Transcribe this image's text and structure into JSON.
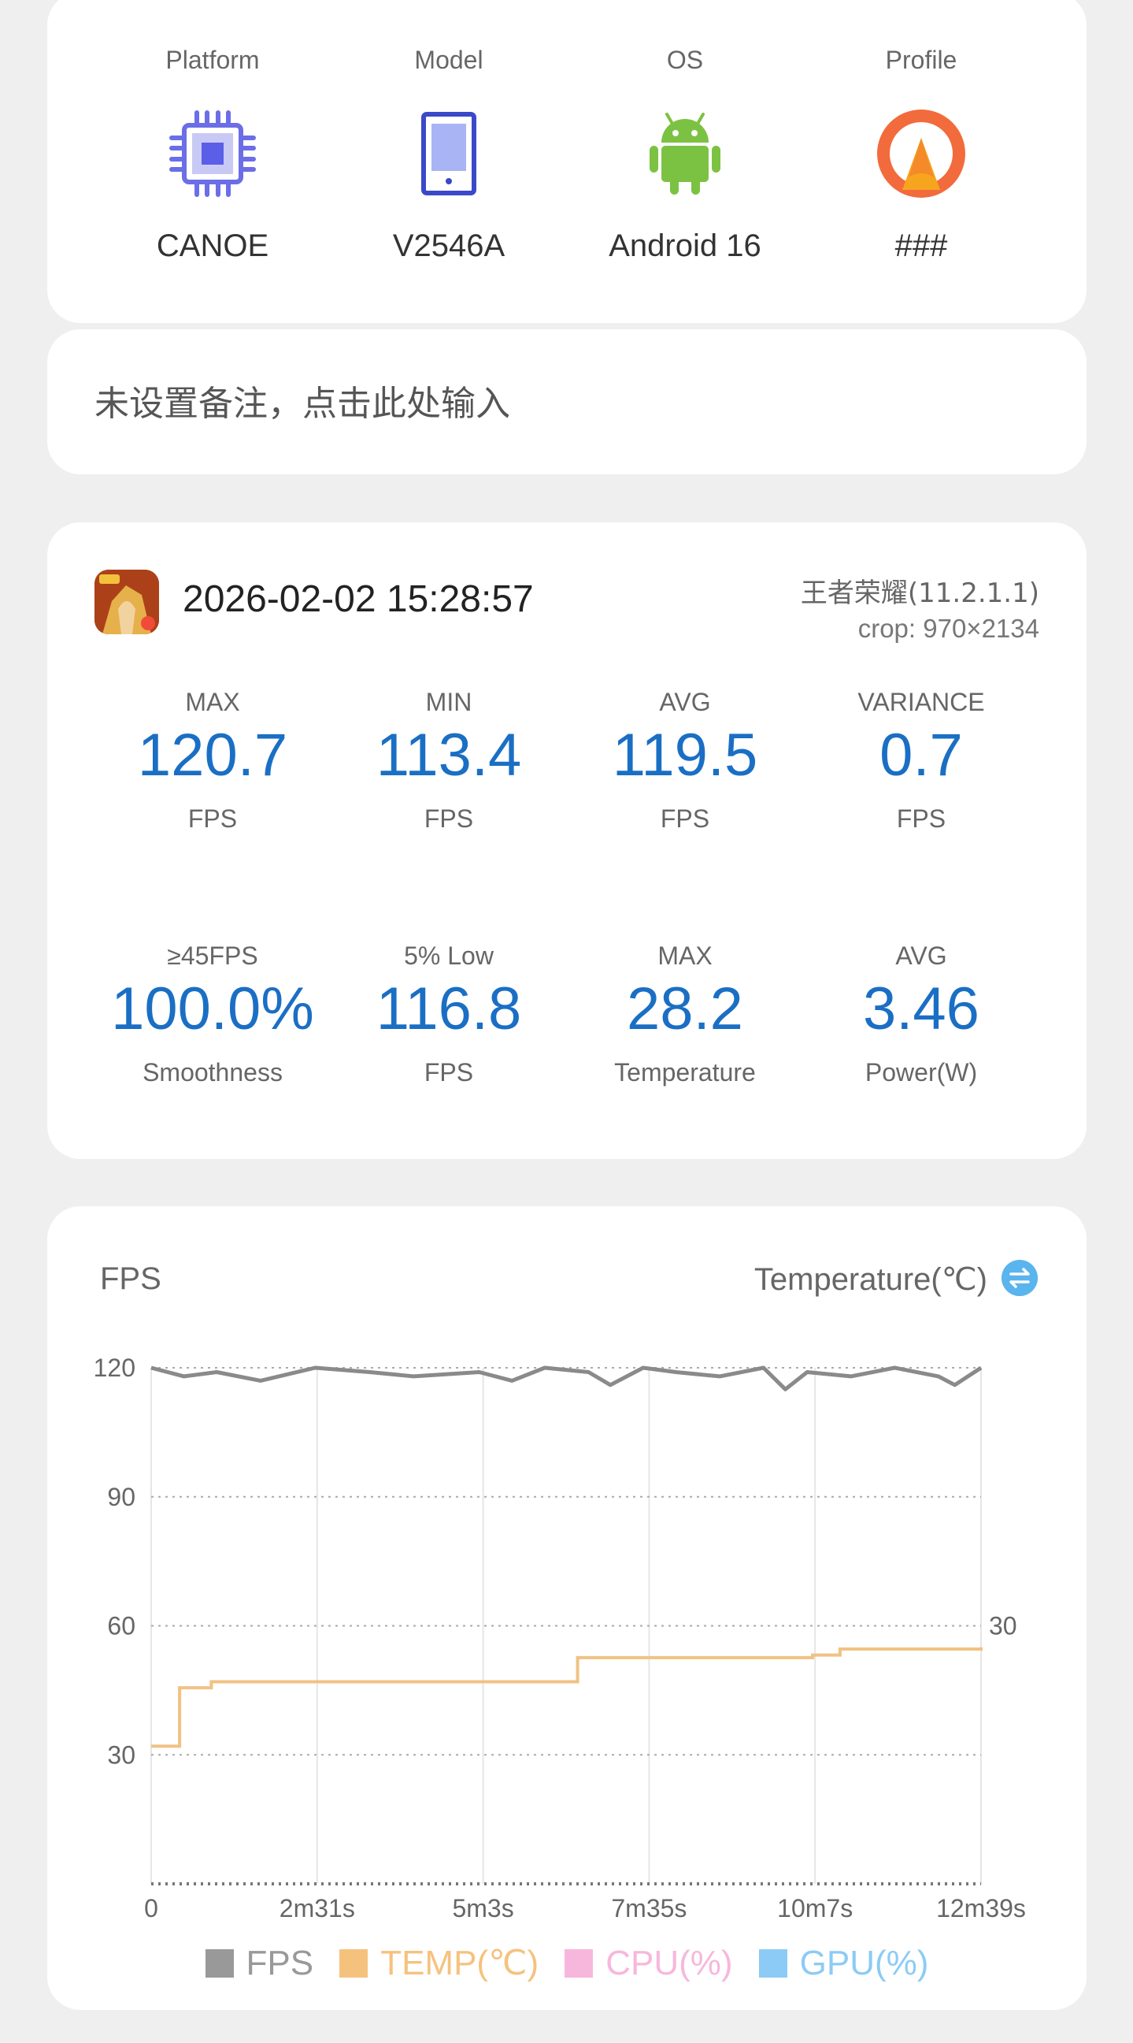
{
  "device": {
    "items": [
      {
        "label": "Platform",
        "value": "CANOE",
        "icon": "chip-icon"
      },
      {
        "label": "Model",
        "value": "V2546A",
        "icon": "phone-icon"
      },
      {
        "label": "OS",
        "value": "Android 16",
        "icon": "android-icon"
      },
      {
        "label": "Profile",
        "value": "###",
        "icon": "profile-icon"
      }
    ]
  },
  "note": {
    "placeholder": "未设置备注，点击此处输入"
  },
  "session": {
    "timestamp": "2026-02-02 15:28:57",
    "app": "王者荣耀(11.2.1.1)",
    "crop": "crop: 970×2134",
    "stats": [
      {
        "top": "MAX",
        "value": "120.7",
        "unit": "FPS"
      },
      {
        "top": "MIN",
        "value": "113.4",
        "unit": "FPS"
      },
      {
        "top": "AVG",
        "value": "119.5",
        "unit": "FPS"
      },
      {
        "top": "VARIANCE",
        "value": "0.7",
        "unit": "FPS"
      },
      {
        "top": "≥45FPS",
        "value": "100.0%",
        "unit": "Smoothness"
      },
      {
        "top": "5% Low",
        "value": "116.8",
        "unit": "FPS"
      },
      {
        "top": "MAX",
        "value": "28.2",
        "unit": "Temperature"
      },
      {
        "top": "AVG",
        "value": "3.46",
        "unit": "Power(W)"
      }
    ]
  },
  "chart": {
    "left_title": "FPS",
    "right_title": "Temperature(℃)",
    "swap_icon": "swap-icon"
  },
  "colors": {
    "accent_blue": "#1a6fc4",
    "fps": "#999999",
    "temp": "#f5c27e",
    "cpu": "#f7b7dc",
    "gpu": "#8ccbf5"
  },
  "chart_data": {
    "type": "line",
    "x_ticks": [
      "0",
      "2m31s",
      "5m3s",
      "7m35s",
      "10m7s",
      "12m39s"
    ],
    "x_range_seconds": [
      0,
      759
    ],
    "y_left": {
      "ticks": [
        "120",
        "90",
        "60",
        "30"
      ],
      "range": [
        0,
        120
      ]
    },
    "y_right": {
      "ticks": [
        "30"
      ]
    },
    "series": [
      {
        "name": "FPS",
        "x_seconds": [
          0,
          30,
          60,
          100,
          150,
          200,
          240,
          300,
          330,
          360,
          400,
          420,
          450,
          480,
          520,
          560,
          580,
          600,
          640,
          680,
          720,
          735,
          759
        ],
        "values": [
          120,
          118,
          119,
          117,
          120,
          119,
          118,
          119,
          117,
          120,
          119,
          116,
          120,
          119,
          118,
          120,
          115,
          119,
          118,
          120,
          118,
          116,
          120
        ]
      },
      {
        "name": "TEMP(℃)",
        "x_seconds": [
          0,
          26,
          55,
          336,
          390,
          605,
          630,
          759
        ],
        "values": [
          16,
          22.8,
          23.5,
          23.5,
          26.3,
          26.6,
          27.3,
          27.5
        ]
      }
    ],
    "legend": [
      "FPS",
      "TEMP(℃)",
      "CPU(%)",
      "GPU(%)"
    ],
    "grid": true,
    "legend_position": "bottom"
  }
}
